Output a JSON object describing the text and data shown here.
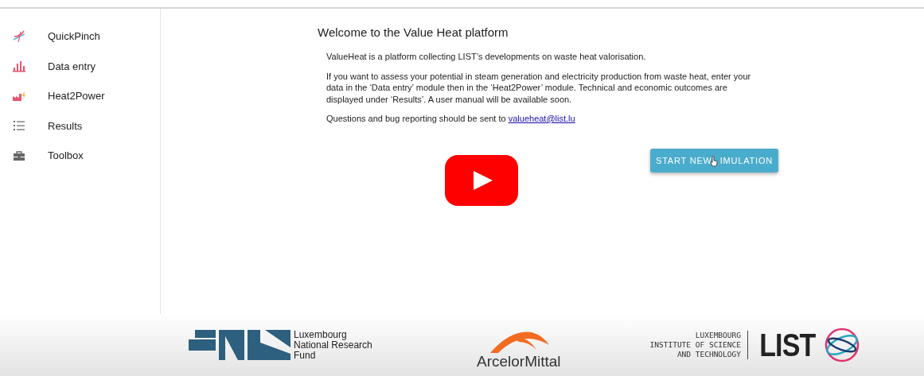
{
  "sidebar": {
    "items": [
      {
        "label": "QuickPinch"
      },
      {
        "label": "Data entry"
      },
      {
        "label": "Heat2Power"
      },
      {
        "label": "Results"
      },
      {
        "label": "Toolbox"
      }
    ]
  },
  "main": {
    "title": "Welcome to the Value Heat platform",
    "paragraphs": [
      "ValueHeat is a platform collecting LIST’s developments on waste heat valorisation.",
      "If you want to assess your potential in steam generation and electricity production from waste heat, enter your data in the ‘Data entry’ module then in the ‘Heat2Power’ module. Technical and economic outcomes are displayed under ‘Results’. A user manual will be available soon."
    ],
    "contact": {
      "text": "Questions and bug reporting should be sent to",
      "link": "valueheat@list.lu"
    },
    "button": {
      "parts": [
        "START NEW",
        "IMULATION"
      ]
    }
  },
  "footer": {
    "fnr": "Luxembourg National Research Fund",
    "arcelor": "ArcelorMittal",
    "list_caption": [
      "LUXEMBOURG",
      "INSTITUTE OF SCIENCE",
      "AND TECHNOLOGY"
    ],
    "list_mark": "LIST"
  }
}
